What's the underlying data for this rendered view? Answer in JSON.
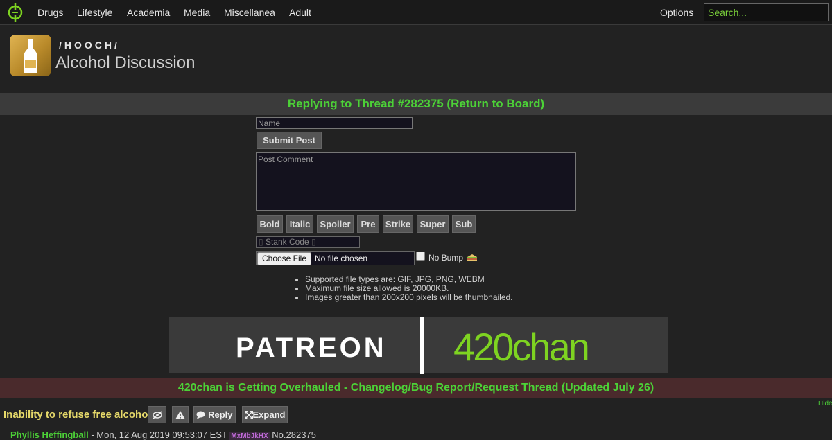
{
  "nav": {
    "items": [
      "Drugs",
      "Lifestyle",
      "Academia",
      "Media",
      "Miscellanea",
      "Adult"
    ],
    "options_label": "Options",
    "search_placeholder": "Search..."
  },
  "board": {
    "path": "/HOOCH/",
    "title": "Alcohol Discussion"
  },
  "reply_banner": "Replying to Thread #282375 (Return to Board)",
  "form": {
    "name_placeholder": "Name",
    "submit_label": "Submit Post",
    "comment_placeholder": "Post Comment",
    "format_buttons": [
      "Bold",
      "Italic",
      "Spoiler",
      "Pre",
      "Strike",
      "Super",
      "Sub"
    ],
    "stank_code_label": "Stank Code",
    "choose_file_label": "Choose File",
    "file_status": "No file chosen",
    "no_bump_label": "No Bump",
    "rules": [
      "Supported file types are: GIF, JPG, PNG, WEBM",
      "Maximum file size allowed is 20000KB.",
      "Images greater than 200x200 pixels will be thumbnailed."
    ]
  },
  "ad": {
    "patreon_text": "PATREON",
    "site_logo_text": "420chan"
  },
  "notice": "420chan is Getting Overhauled - Changelog/Bug Report/Request Thread (Updated July 26)",
  "hide_label": "Hide",
  "thread": {
    "subject": "Inability to refuse free alcohol",
    "reply_label": "Reply",
    "expand_label": "Expand",
    "poster_name": "Phyllis Heffingball",
    "date": "Mon, 12 Aug 2019 09:53:07 EST",
    "poster_id": "MxMbJkHX",
    "post_number": "No.282375"
  },
  "colors": {
    "accent_green": "#4cd137",
    "logo_green": "#7ed321",
    "subject_yellow": "#e6d96a",
    "notice_bg": "#4a2a2c"
  }
}
